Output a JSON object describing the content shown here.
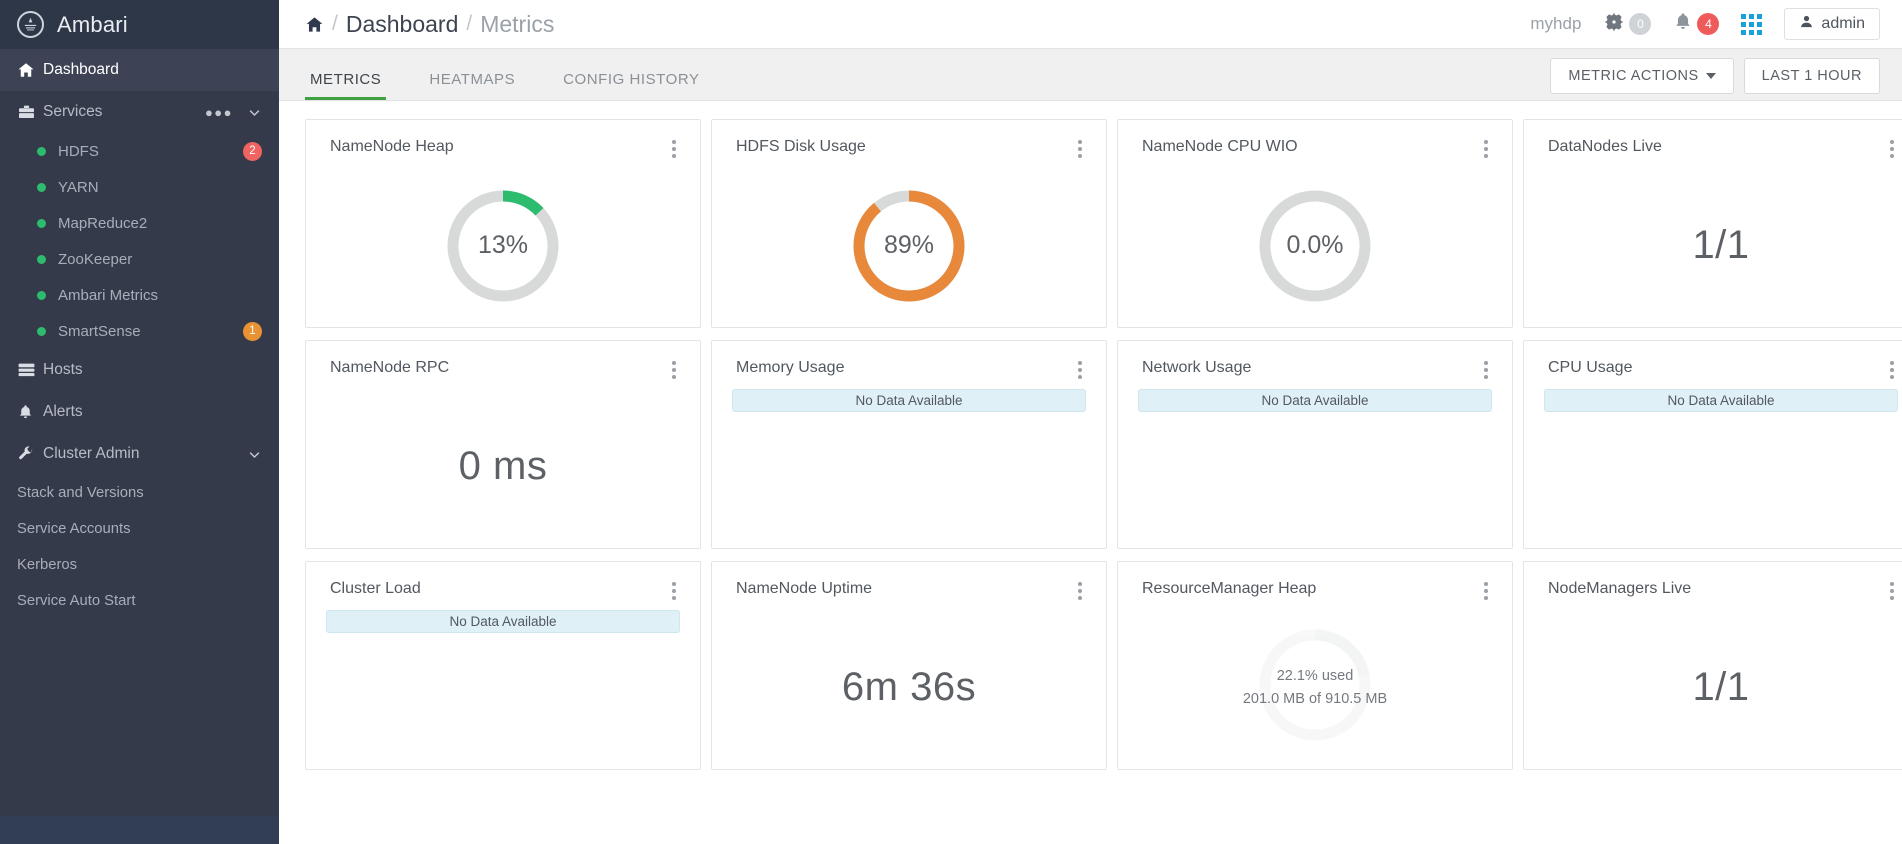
{
  "sidebar": {
    "brand": "Ambari",
    "brand_logo_icon": "ambari-logo-icon",
    "dashboard": {
      "label": "Dashboard",
      "icon": "home-icon"
    },
    "services": {
      "label": "Services",
      "icon": "briefcase-icon",
      "more_icon": "ellipsis-icon",
      "chevron_icon": "chevron-down-icon",
      "items": [
        {
          "label": "HDFS",
          "status": "green",
          "badge": "2",
          "badge_color": "#ef6461"
        },
        {
          "label": "YARN",
          "status": "green",
          "badge": "",
          "badge_color": ""
        },
        {
          "label": "MapReduce2",
          "status": "green",
          "badge": "",
          "badge_color": ""
        },
        {
          "label": "ZooKeeper",
          "status": "green",
          "badge": "",
          "badge_color": ""
        },
        {
          "label": "Ambari Metrics",
          "status": "green",
          "badge": "",
          "badge_color": ""
        },
        {
          "label": "SmartSense",
          "status": "green",
          "badge": "1",
          "badge_color": "#e89234"
        }
      ]
    },
    "hosts": {
      "label": "Hosts",
      "icon": "server-icon"
    },
    "alerts": {
      "label": "Alerts",
      "icon": "bell-icon"
    },
    "cluster_admin": {
      "label": "Cluster Admin",
      "icon": "wrench-icon",
      "chevron_icon": "chevron-down-icon",
      "items": [
        {
          "label": "Stack and Versions"
        },
        {
          "label": "Service Accounts"
        },
        {
          "label": "Kerberos"
        },
        {
          "label": "Service Auto Start"
        }
      ]
    }
  },
  "topbar": {
    "home_icon": "home-icon",
    "breadcrumb": {
      "sep": "/",
      "level1": "Dashboard",
      "level2": "Metrics"
    },
    "cluster_name": "myhdp",
    "gear": {
      "icon": "gear-icon",
      "count": "0"
    },
    "bell": {
      "icon": "bell-icon",
      "count": "4"
    },
    "apps_icon": "grid-apps-icon",
    "user": {
      "icon": "user-icon",
      "label": "admin"
    }
  },
  "tabs": [
    {
      "label": "METRICS",
      "active": true
    },
    {
      "label": "HEATMAPS",
      "active": false
    },
    {
      "label": "CONFIG HISTORY",
      "active": false
    }
  ],
  "actions": {
    "metric_actions": "METRIC ACTIONS",
    "metric_actions_caret": "caret-down-icon",
    "time_range": "LAST 1 HOUR"
  },
  "colors": {
    "green": "#2dbb6e",
    "orange": "#e8883a",
    "track": "#d8dada",
    "tab_active": "#3fa13f",
    "sidebar": "#343a4a"
  },
  "widgets": [
    {
      "title": "NameNode Heap",
      "type": "gauge",
      "value_label": "13%",
      "percent": 13,
      "color": "#2dbb6e",
      "kebab_icon": "kebab-menu-icon"
    },
    {
      "title": "HDFS Disk Usage",
      "type": "gauge",
      "value_label": "89%",
      "percent": 89,
      "color": "#e8883a",
      "kebab_icon": "kebab-menu-icon"
    },
    {
      "title": "NameNode CPU WIO",
      "type": "gauge",
      "value_label": "0.0%",
      "percent": 0,
      "color": "#d8dada",
      "kebab_icon": "kebab-menu-icon"
    },
    {
      "title": "DataNodes Live",
      "type": "number",
      "value_label": "1/1",
      "kebab_icon": "kebab-menu-icon"
    },
    {
      "title": "NameNode RPC",
      "type": "number",
      "value_label": "0 ms",
      "kebab_icon": "kebab-menu-icon"
    },
    {
      "title": "Memory Usage",
      "type": "nodata",
      "value_label": "No Data Available",
      "kebab_icon": "kebab-menu-icon"
    },
    {
      "title": "Network Usage",
      "type": "nodata",
      "value_label": "No Data Available",
      "kebab_icon": "kebab-menu-icon"
    },
    {
      "title": "CPU Usage",
      "type": "nodata",
      "value_label": "No Data Available",
      "kebab_icon": "kebab-menu-icon"
    },
    {
      "title": "Cluster Load",
      "type": "nodata",
      "value_label": "No Data Available",
      "kebab_icon": "kebab-menu-icon"
    },
    {
      "title": "NameNode Uptime",
      "type": "number",
      "value_label": "6m 36s",
      "kebab_icon": "kebab-menu-icon"
    },
    {
      "title": "ResourceManager Heap",
      "type": "heap",
      "percent": 22.1,
      "ghost_label": "22%",
      "line1": "22.1% used",
      "line2": "201.0 MB of 910.5 MB",
      "kebab_icon": "kebab-menu-icon"
    },
    {
      "title": "NodeManagers Live",
      "type": "number",
      "value_label": "1/1",
      "kebab_icon": "kebab-menu-icon"
    }
  ]
}
